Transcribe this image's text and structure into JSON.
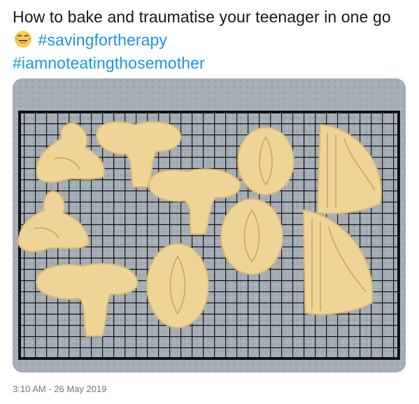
{
  "tweet": {
    "text_part1": "How to bake and traumatise your teenager in one go",
    "emoji_icon": "face-with-tears-of-joy-icon",
    "hashtag1": "#savingfortherapy",
    "hashtag2": "#iamnoteatingthosemother",
    "timestamp": "3:10 AM - 26 May 2019"
  },
  "media": {
    "image_icon": "cookies-on-cooling-rack-photo"
  },
  "colors": {
    "text": "#14171a",
    "link": "#1b95e0",
    "meta": "#657786",
    "cookie": "#efd497",
    "rack": "#161616",
    "counter": "#a3acb4"
  }
}
